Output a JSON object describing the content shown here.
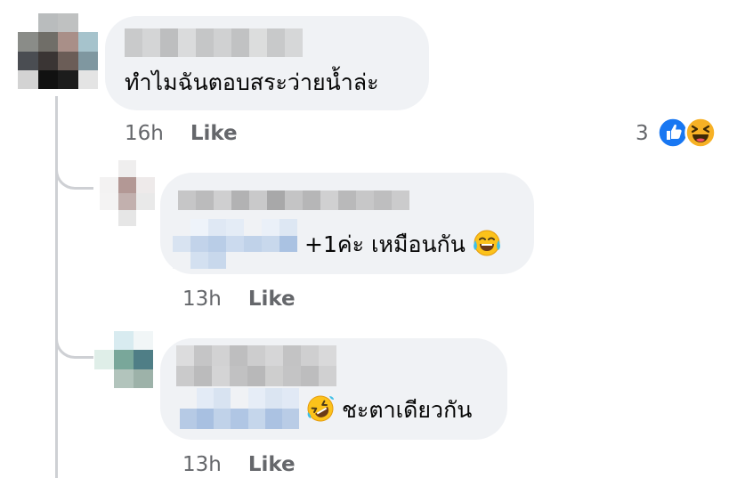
{
  "comments": [
    {
      "text": "ทำไมฉันตอบสระว่ายน้ำล่ะ",
      "time": "16h",
      "like_label": "Like",
      "reaction_count": "3",
      "reactions": [
        "like-reaction-icon",
        "haha-reaction-icon"
      ]
    }
  ],
  "replies": [
    {
      "text": "+1ค่ะ เหมือนกัน",
      "emoji": "tears-of-joy-emoji",
      "time": "13h",
      "like_label": "Like"
    },
    {
      "text": "ชะตาเดียวกัน",
      "emoji": "rolling-on-floor-laughing-emoji",
      "time": "13h",
      "like_label": "Like"
    }
  ],
  "colors": {
    "bubble": "#f0f2f5",
    "meta_text": "#65676b",
    "like_blue": "#1877f2",
    "haha_yellow": "#f7b125",
    "mention_blur": "#c2d3ea"
  }
}
